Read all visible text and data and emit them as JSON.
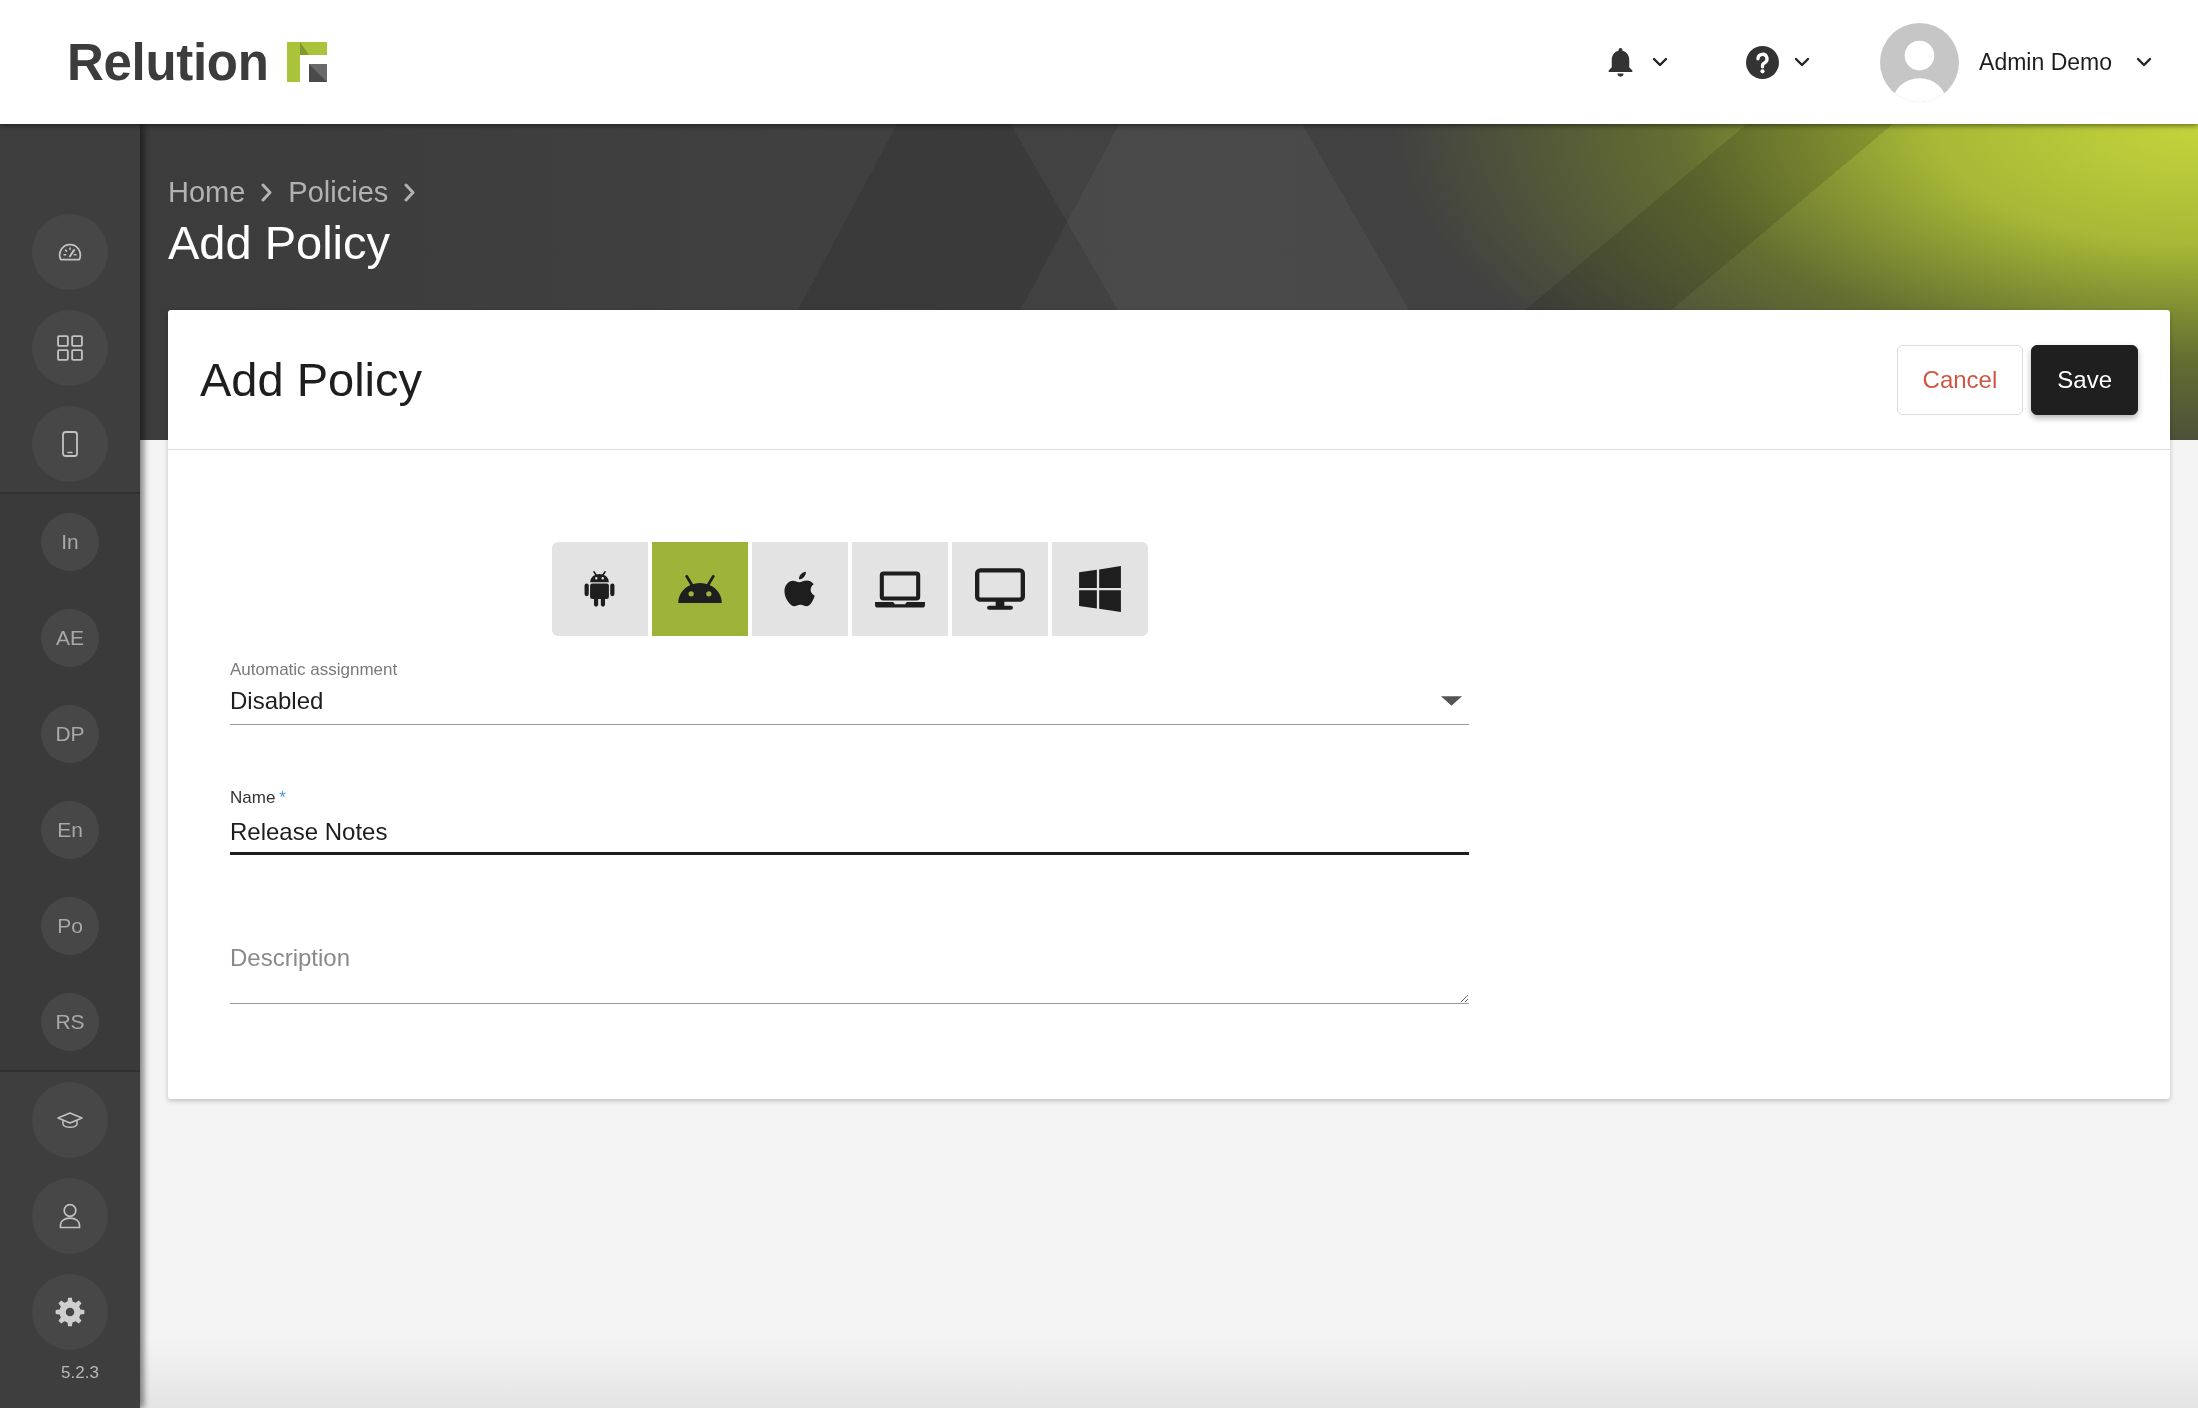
{
  "header": {
    "logo_text": "Relution",
    "user": {
      "name": "Admin Demo"
    }
  },
  "sidebar": {
    "sections": [
      {
        "items": [
          {
            "kind": "icon"
          },
          {
            "kind": "icon"
          },
          {
            "kind": "icon"
          }
        ]
      },
      {
        "items": [
          {
            "kind": "label",
            "label": "In"
          },
          {
            "kind": "label",
            "label": "AE"
          },
          {
            "kind": "label",
            "label": "DP"
          },
          {
            "kind": "label",
            "label": "En"
          },
          {
            "kind": "label",
            "label": "Po"
          },
          {
            "kind": "label",
            "label": "RS"
          }
        ]
      },
      {
        "items": [
          {
            "kind": "icon"
          },
          {
            "kind": "icon"
          },
          {
            "kind": "icon"
          }
        ]
      }
    ],
    "version": "5.2.3"
  },
  "breadcrumb": [
    "Home",
    "Policies"
  ],
  "page_title": "Add Policy",
  "card": {
    "title": "Add Policy",
    "buttons": [
      {
        "label": "Cancel",
        "kind": "secondary"
      },
      {
        "label": "Save",
        "kind": "primary"
      }
    ],
    "platforms": [
      {
        "selected": false
      },
      {
        "selected": true
      },
      {
        "selected": false
      },
      {
        "selected": false
      },
      {
        "selected": false
      },
      {
        "selected": false
      }
    ],
    "fields": [
      {
        "kind": "select",
        "label": "Automatic assignment",
        "value": "Disabled",
        "focused": false
      },
      {
        "kind": "text",
        "label": "Name",
        "required_mark": "*",
        "value": "Release Notes",
        "focused": true
      },
      {
        "kind": "textarea",
        "placeholder": "Description",
        "focused": false
      }
    ]
  }
}
